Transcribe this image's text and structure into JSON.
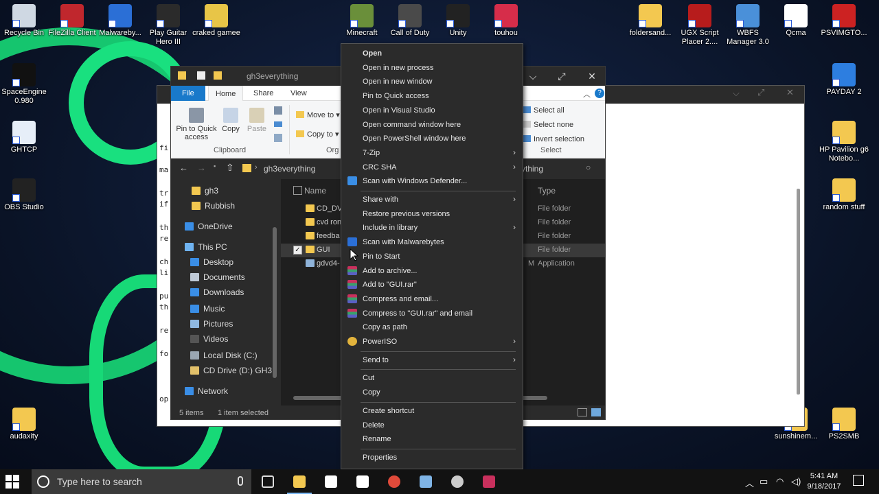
{
  "desktop": {
    "icons_left": [
      {
        "label": "Recycle Bin",
        "icon": "recycle-bin-icon",
        "color": "#cfd8e3"
      },
      {
        "label": "FileZilla Client",
        "icon": "filezilla-icon",
        "color": "#c0272d"
      },
      {
        "label": "Malwareby...",
        "icon": "malwarebytes-icon",
        "color": "#2b6fd6"
      },
      {
        "label": "Play Guitar Hero III",
        "icon": "guitar-hero-icon",
        "color": "#2b2b2b"
      },
      {
        "label": "craked gamee",
        "icon": "folder-zip-icon",
        "color": "#e8c547"
      },
      {
        "label": "SpaceEngine 0.980",
        "icon": "spaceengine-icon",
        "color": "#111111"
      },
      {
        "label": "GHTCP",
        "icon": "document-icon",
        "color": "#e6eef8"
      },
      {
        "label": "OBS Studio",
        "icon": "obs-icon",
        "color": "#222222"
      },
      {
        "label": "audaxity",
        "icon": "folder-icon",
        "color": "#f3c850"
      }
    ],
    "icons_top_mid": [
      {
        "label": "Minecraft",
        "icon": "minecraft-icon",
        "color": "#6a8f3a"
      },
      {
        "label": "Call of Duty",
        "icon": "call-of-duty-icon",
        "color": "#4a4a4a"
      },
      {
        "label": "Unity",
        "icon": "unity-icon",
        "color": "#222222"
      },
      {
        "label": "touhou",
        "icon": "touhou-icon",
        "color": "#d62d4a"
      }
    ],
    "icons_right": [
      {
        "label": "foldersand...",
        "icon": "folder-icon",
        "color": "#f3c850"
      },
      {
        "label": "UGX Script Placer 2....",
        "icon": "ugx-icon",
        "color": "#b71c1c"
      },
      {
        "label": "WBFS Manager 3.0",
        "icon": "wbfs-icon",
        "color": "#4a90d9"
      },
      {
        "label": "Qcma",
        "icon": "qcma-icon",
        "color": "#ffffff"
      },
      {
        "label": "PSVIMGTO...",
        "icon": "psvimgtools-icon",
        "color": "#cc2222"
      },
      {
        "label": "PAYDAY 2",
        "icon": "payday-icon",
        "color": "#2d7ee0"
      },
      {
        "label": "HP Pavilion g6 Notebo...",
        "icon": "folder-icon",
        "color": "#f3c850"
      },
      {
        "label": "random stuff",
        "icon": "folder-icon",
        "color": "#f3c850"
      },
      {
        "label": "sunshinem...",
        "icon": "folder-icon",
        "color": "#f3c850"
      },
      {
        "label": "PS2SMB",
        "icon": "folder-icon",
        "color": "#f3c850"
      }
    ]
  },
  "back_window": {
    "text_lines": [
      "fi",
      "ma",
      "tr",
      "if",
      "th",
      "re",
      "ch",
      "li",
      "pu",
      "th",
      "re",
      "fo",
      "op"
    ]
  },
  "explorer": {
    "title": "gh3everything",
    "tabs": {
      "file": "File",
      "home": "Home",
      "share": "Share",
      "view": "View"
    },
    "ribbon": {
      "pin": "Pin to Quick access",
      "copy": "Copy",
      "paste": "Paste",
      "move_to": "Move to",
      "copy_to": "Copy to",
      "clipboard_group": "Clipboard",
      "organize_group": "Org",
      "select_all": "Select all",
      "select_none": "Select none",
      "invert_selection": "Invert selection",
      "select_group": "Select"
    },
    "address": {
      "crumb": "gh3everything",
      "right_crumb": "ything"
    },
    "nav": [
      {
        "label": "gh3",
        "icon": "folder-icon",
        "color": "#f3c850"
      },
      {
        "label": "Rubbish",
        "icon": "folder-icon",
        "color": "#f3c850"
      },
      {
        "label": "OneDrive",
        "icon": "onedrive-icon",
        "color": "#3a8ee6"
      },
      {
        "label": "This PC",
        "icon": "computer-icon",
        "color": "#6fb3f0"
      },
      {
        "label": "Desktop",
        "icon": "desktop-icon",
        "color": "#3a8ee6"
      },
      {
        "label": "Documents",
        "icon": "documents-icon",
        "color": "#bfc9d6"
      },
      {
        "label": "Downloads",
        "icon": "downloads-icon",
        "color": "#3a8ee6"
      },
      {
        "label": "Music",
        "icon": "music-icon",
        "color": "#3a8ee6"
      },
      {
        "label": "Pictures",
        "icon": "pictures-icon",
        "color": "#8fb8e0"
      },
      {
        "label": "Videos",
        "icon": "videos-icon",
        "color": "#555555"
      },
      {
        "label": "Local Disk (C:)",
        "icon": "disk-icon",
        "color": "#9aa6b2"
      },
      {
        "label": "CD Drive (D:) GH3",
        "icon": "cd-icon",
        "color": "#e2c06a"
      },
      {
        "label": "Network",
        "icon": "network-icon",
        "color": "#3a8ee6"
      }
    ],
    "columns": {
      "name": "Name",
      "type": "Type"
    },
    "files": [
      {
        "name": "CD_DVI",
        "type": "File folder",
        "icon": "folder-icon"
      },
      {
        "name": "cvd ron",
        "type": "File folder",
        "icon": "folder-icon"
      },
      {
        "name": "feedba",
        "type": "File folder",
        "icon": "folder-icon"
      },
      {
        "name": "GUI",
        "type": "File folder",
        "icon": "folder-icon",
        "selected": true
      },
      {
        "name": "gdvd4-",
        "type": "Application",
        "icon": "application-icon",
        "type_prefix": "M"
      }
    ],
    "status": {
      "items": "5 items",
      "selected": "1 item selected"
    }
  },
  "context_menu": {
    "items": [
      {
        "label": "Open",
        "bold": true
      },
      {
        "label": "Open in new process"
      },
      {
        "label": "Open in new window"
      },
      {
        "label": "Pin to Quick access"
      },
      {
        "label": "Open in Visual Studio"
      },
      {
        "label": "Open command window here"
      },
      {
        "label": "Open PowerShell window here"
      },
      {
        "label": "7-Zip",
        "submenu": true
      },
      {
        "label": "CRC SHA",
        "submenu": true
      },
      {
        "label": "Scan with Windows Defender...",
        "icon": "windows-defender-icon"
      },
      {
        "label": "Share with",
        "submenu": true,
        "sep_before": true
      },
      {
        "label": "Restore previous versions"
      },
      {
        "label": "Include in library",
        "submenu": true
      },
      {
        "label": "Scan with Malwarebytes",
        "icon": "malwarebytes-icon"
      },
      {
        "label": "Pin to Start"
      },
      {
        "label": "Add to archive...",
        "icon": "winrar-icon"
      },
      {
        "label": "Add to \"GUI.rar\"",
        "icon": "winrar-icon"
      },
      {
        "label": "Compress and email...",
        "icon": "winrar-icon"
      },
      {
        "label": "Compress to \"GUI.rar\" and email",
        "icon": "winrar-icon"
      },
      {
        "label": "Copy as path"
      },
      {
        "label": "PowerISO",
        "submenu": true,
        "icon": "poweriso-icon"
      },
      {
        "label": "Send to",
        "submenu": true,
        "sep_before": true
      },
      {
        "label": "Cut",
        "sep_before": true
      },
      {
        "label": "Copy"
      },
      {
        "label": "Create shortcut",
        "sep_before": true
      },
      {
        "label": "Delete"
      },
      {
        "label": "Rename"
      },
      {
        "label": "Properties",
        "sep_before": true
      }
    ]
  },
  "taskbar": {
    "search_placeholder": "Type here to search",
    "apps": [
      {
        "name": "task-view-icon",
        "color": "#dddddd"
      },
      {
        "name": "file-explorer-icon",
        "color": "#f3c850",
        "active": true
      },
      {
        "name": "store-icon",
        "color": "#ffffff"
      },
      {
        "name": "mail-icon",
        "color": "#ffffff"
      },
      {
        "name": "chrome-icon",
        "color": "#e04a3a"
      },
      {
        "name": "notepad-icon",
        "color": "#7fb4e6"
      },
      {
        "name": "obs-icon",
        "color": "#cccccc"
      },
      {
        "name": "winrar-icon",
        "color": "#c9305d"
      }
    ],
    "time": "5:41 AM",
    "date": "9/18/2017"
  },
  "colors": {
    "accent": "#1979ca",
    "selection": "#3a3a3a",
    "glow": "#19e27c"
  }
}
